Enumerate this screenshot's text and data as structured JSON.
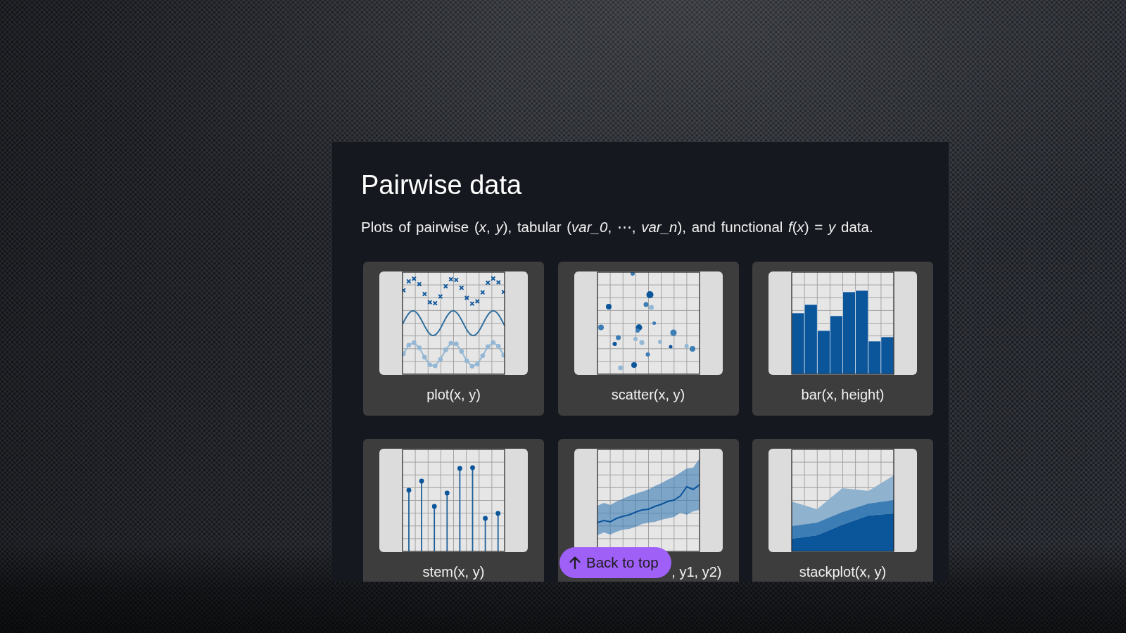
{
  "section": {
    "title": "Pairwise data",
    "description": "Plots of pairwise (*x*, *y*), tabular (*var_0*, ⋯, *var_n*), and functional *f*(*x*) = *y* data."
  },
  "cards": [
    {
      "kind": "line",
      "label": "plot(x, y)",
      "label_covered": false
    },
    {
      "kind": "scatter",
      "label": "scatter(x, y)",
      "label_covered": false
    },
    {
      "kind": "bar",
      "label": "bar(x, height)",
      "label_covered": false
    },
    {
      "kind": "stem",
      "label": "stem(x, y)",
      "label_covered": false
    },
    {
      "kind": "band",
      "label": ", y1, y2)",
      "label_covered": true
    },
    {
      "kind": "stack",
      "label": "stackplot(x, y)",
      "label_covered": false
    }
  ],
  "back_to_top": {
    "label": "Back to top"
  }
}
